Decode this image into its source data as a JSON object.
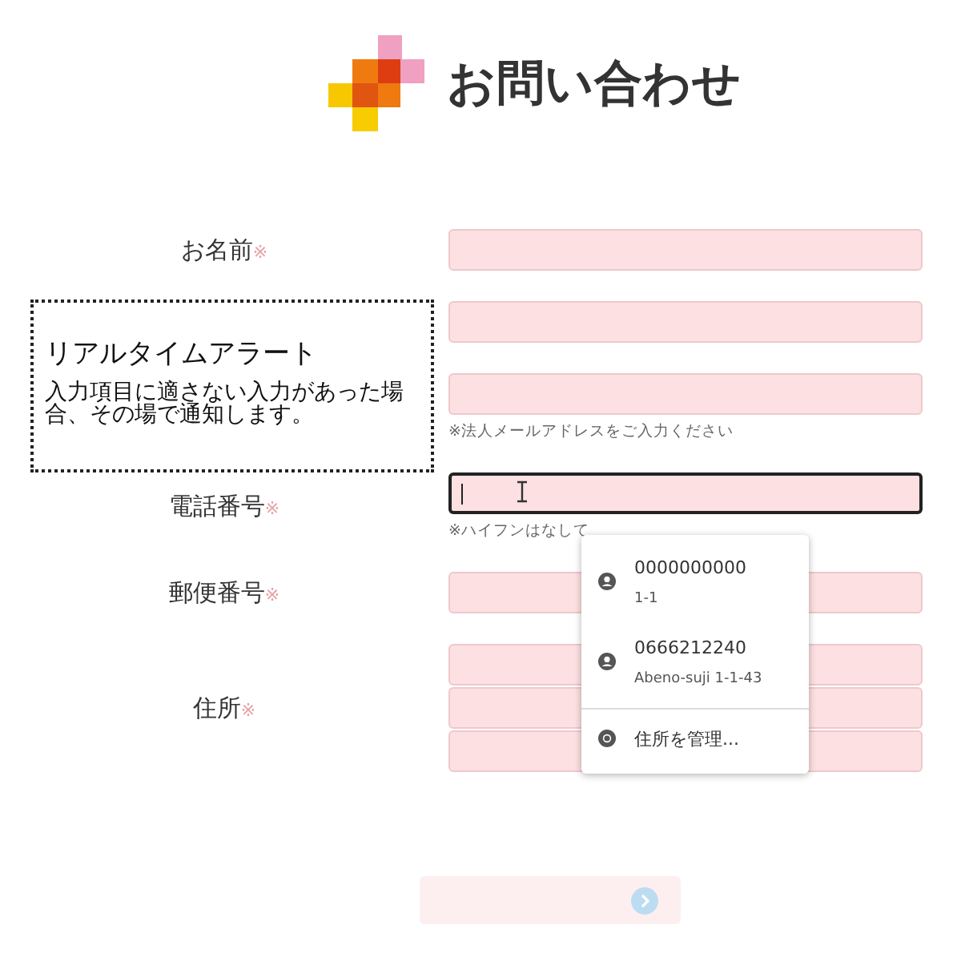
{
  "title": "お問い合わせ",
  "rows": [
    {
      "label": "お名前",
      "required_mark": "※",
      "inputs": [
        {
          "focused": false
        }
      ]
    },
    {
      "inputs": [
        {
          "focused": false
        }
      ]
    },
    {
      "inputs": [
        {
          "focused": false
        }
      ],
      "hint": "※法人メールアドレスをご入力ください"
    },
    {
      "label": "電話番号",
      "required_mark": "※",
      "inputs": [
        {
          "focused": true
        }
      ],
      "hint": "※ハイフンはなして"
    },
    {
      "label": "郵便番号",
      "required_mark": "※",
      "inputs": [
        {
          "focused": false
        }
      ]
    },
    {
      "label": "住所",
      "required_mark": "※",
      "inputs": [
        {
          "focused": false
        },
        {
          "focused": false
        },
        {
          "focused": false
        }
      ]
    }
  ],
  "alert": {
    "title": "リアルタイムアラート",
    "body": "入力項目に適さない入力があった場合、その場で通知します。"
  },
  "autofill": [
    {
      "kind": "profile",
      "primary": "0000000000",
      "secondary": "1-1"
    },
    {
      "kind": "profile",
      "primary": "0666212240",
      "secondary": "Abeno-suji 1-1-43"
    },
    {
      "kind": "manage",
      "primary": "住所を管理..."
    }
  ],
  "submit": {
    "disabled": true
  }
}
